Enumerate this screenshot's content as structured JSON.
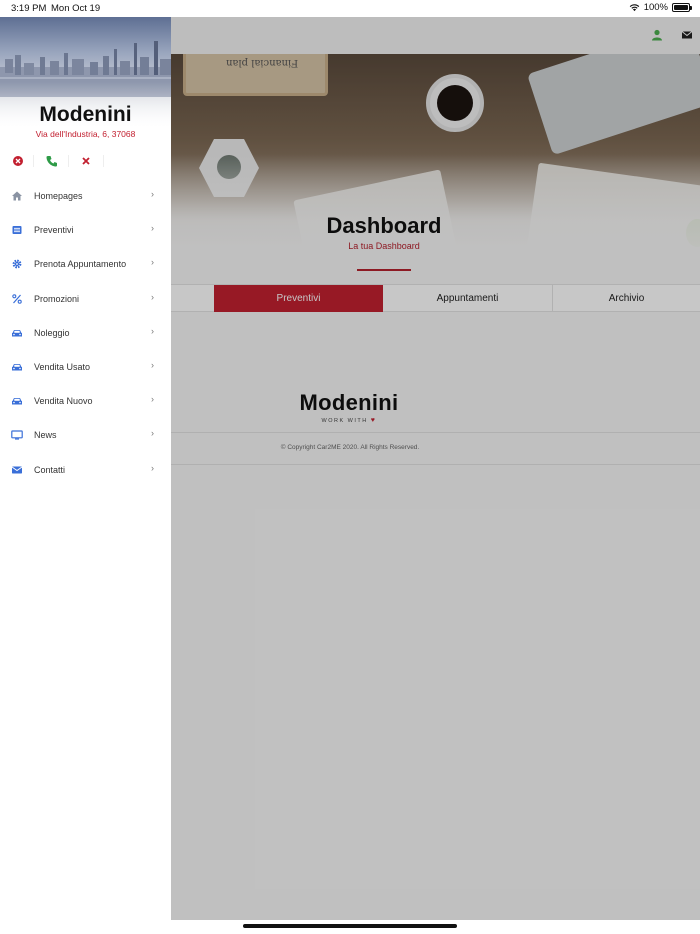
{
  "status_bar": {
    "time": "3:19 PM",
    "date": "Mon Oct 19",
    "battery": "100%",
    "battery_level": 1.0
  },
  "drawer": {
    "brand": "Modenini",
    "address": "Via dell'Industria, 6, 37068",
    "quick_actions": [
      {
        "icon": "map-marker-icon",
        "color": "#c22030"
      },
      {
        "icon": "phone-icon",
        "color": "#2e9b47"
      },
      {
        "icon": "close-icon",
        "color": "#c22030"
      }
    ],
    "menu": [
      {
        "label": "Homepages",
        "icon": "home-icon",
        "color": "#8a93a3"
      },
      {
        "label": "Preventivi",
        "icon": "list-icon",
        "color": "#3a6fd8"
      },
      {
        "label": "Prenota Appuntamento",
        "icon": "gear-icon",
        "color": "#3a6fd8"
      },
      {
        "label": "Promozioni",
        "icon": "percent-icon",
        "color": "#3a6fd8"
      },
      {
        "label": "Noleggio",
        "icon": "car-icon",
        "color": "#3a6fd8"
      },
      {
        "label": "Vendita Usato",
        "icon": "car-icon",
        "color": "#3a6fd8"
      },
      {
        "label": "Vendita Nuovo",
        "icon": "car-icon",
        "color": "#3a6fd8"
      },
      {
        "label": "News",
        "icon": "monitor-icon",
        "color": "#3a6fd8"
      },
      {
        "label": "Contatti",
        "icon": "envelope-icon",
        "color": "#3a6fd8"
      }
    ],
    "chevron": "›"
  },
  "main": {
    "hero": {
      "clipboard_text": "Financial plan"
    },
    "title": "Dashboard",
    "subtitle": "La tua Dashboard",
    "tabs": [
      {
        "label": "Preventivi",
        "active": true
      },
      {
        "label": "Appuntamenti",
        "active": false
      },
      {
        "label": "Archivio",
        "active": false
      }
    ],
    "footer": {
      "brand": "Modenini",
      "tagline": "WORK WITH",
      "heart": "♥",
      "copyright": "© Copyright Car2ME 2020. All Rights Reserved."
    },
    "top_icons": [
      {
        "icon": "user-icon",
        "color": "#4caf50"
      },
      {
        "icon": "envelope-icon",
        "color": "#222222"
      }
    ]
  },
  "colors": {
    "accent": "#c22030",
    "menu_icon": "#3a6fd8"
  }
}
